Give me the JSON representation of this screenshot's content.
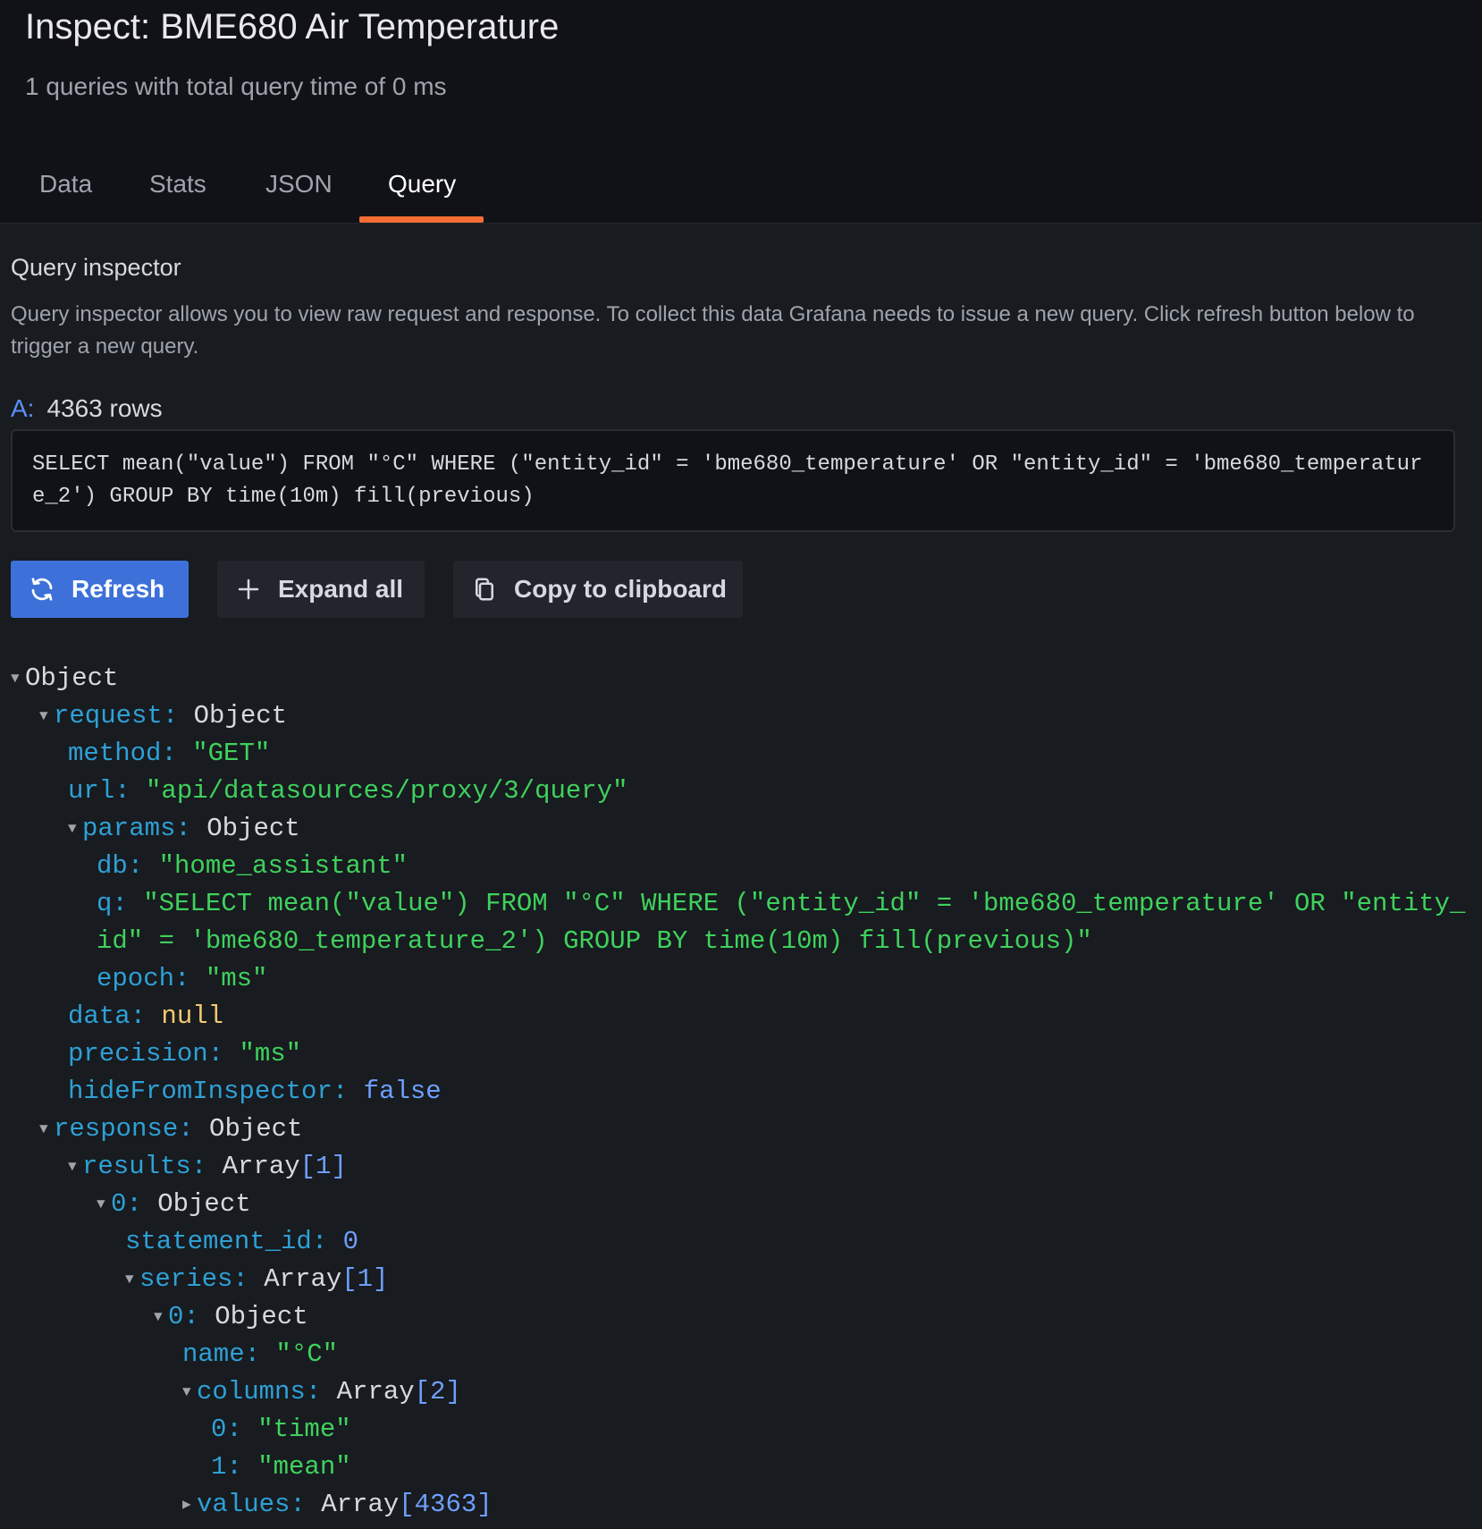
{
  "header": {
    "title": "Inspect: BME680 Air Temperature",
    "subtitle": "1 queries with total query time of 0 ms"
  },
  "tabs": [
    {
      "label": "Data",
      "active": false
    },
    {
      "label": "Stats",
      "active": false
    },
    {
      "label": "JSON",
      "active": false
    },
    {
      "label": "Query",
      "active": true
    }
  ],
  "inspector": {
    "title": "Query inspector",
    "description": "Query inspector allows you to view raw request and response. To collect this data Grafana needs to issue a new query. Click refresh button below to trigger a new query.",
    "ref_id": "A:",
    "rows": "4363 rows",
    "query": "SELECT mean(\"value\") FROM \"°C\" WHERE (\"entity_id\" = 'bme680_temperature' OR \"entity_id\" = 'bme680_temperature_2')  GROUP BY time(10m) fill(previous)"
  },
  "buttons": {
    "refresh": "Refresh",
    "expand_all": "Expand all",
    "copy": "Copy to clipboard"
  },
  "tree": {
    "root": "Object",
    "request_key": "request:",
    "request_type": "Object",
    "method_key": "method:",
    "method_val": "\"GET\"",
    "url_key": "url:",
    "url_val": "\"api/datasources/proxy/3/query\"",
    "params_key": "params:",
    "params_type": "Object",
    "db_key": "db:",
    "db_val": "\"home_assistant\"",
    "q_key": "q:",
    "q_val_line1": "\"SELECT mean(\"value\") FROM \"°C\" WHERE (\"entity_id\" = 'bme680_temperature' OR \"entity_",
    "q_val_line2": "id\" = 'bme680_temperature_2')  GROUP BY time(10m) fill(previous)\"",
    "epoch_key": "epoch:",
    "epoch_val": "\"ms\"",
    "data_key": "data:",
    "data_val": "null",
    "precision_key": "precision:",
    "precision_val": "\"ms\"",
    "hide_key": "hideFromInspector:",
    "hide_val": "false",
    "response_key": "response:",
    "response_type": "Object",
    "results_key": "results:",
    "results_type": "Array",
    "results_len": "[1]",
    "r0_key": "0:",
    "r0_type": "Object",
    "statement_key": "statement_id:",
    "statement_val": "0",
    "series_key": "series:",
    "series_type": "Array",
    "series_len": "[1]",
    "s0_key": "0:",
    "s0_type": "Object",
    "name_key": "name:",
    "name_val": "\"°C\"",
    "columns_key": "columns:",
    "columns_type": "Array",
    "columns_len": "[2]",
    "c0_key": "0:",
    "c0_val": "\"time\"",
    "c1_key": "1:",
    "c1_val": "\"mean\"",
    "values_key": "values:",
    "values_type": "Array",
    "values_len": "[4363]"
  },
  "colors": {
    "accent_tab": "#f46e35",
    "primary_button": "#3d71d9",
    "json_key": "#2ea0d6",
    "json_string": "#3fd15d",
    "json_null": "#f2c96d",
    "json_bool_number": "#6e9fff"
  }
}
